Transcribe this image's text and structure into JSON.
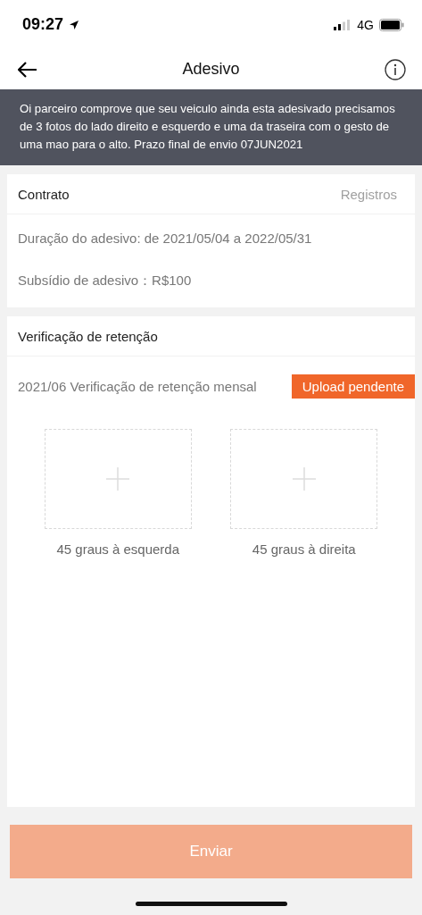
{
  "status_bar": {
    "time": "09:27",
    "network": "4G"
  },
  "header": {
    "title": "Adesivo"
  },
  "notice": "Oi parceiro comprove que seu veiculo ainda esta adesivado precisamos de 3 fotos do lado direito e esquerdo e uma da traseira com o gesto de uma mao para o alto. Prazo final de envio 07JUN2021",
  "contract": {
    "title": "Contrato",
    "link": "Registros",
    "lines": [
      "Duração do adesivo: de 2021/05/04 a 2022/05/31",
      "Subsídio de adesivo：R$100"
    ]
  },
  "retention": {
    "title": "Verificação de retenção",
    "period": "2021/06 Verificação de retenção mensal",
    "status": "Upload pendente",
    "photos": [
      {
        "label": "45 graus à esquerda"
      },
      {
        "label": "45 graus à direita"
      }
    ]
  },
  "submit": {
    "label": "Enviar",
    "disabled": true
  }
}
